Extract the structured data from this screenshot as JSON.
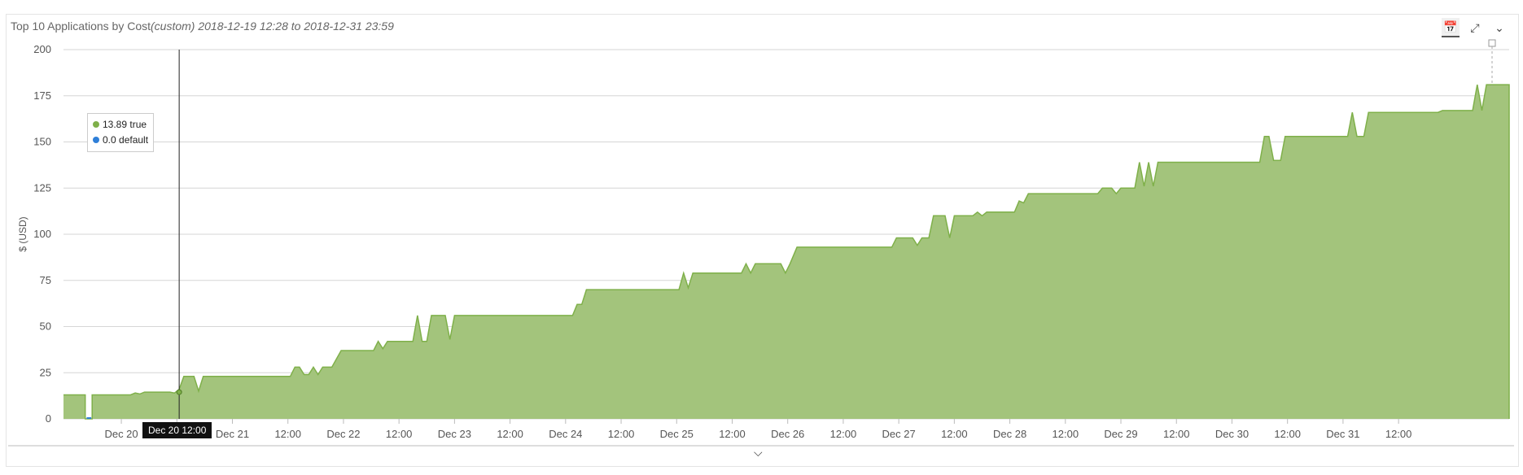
{
  "header": {
    "title_main": "Top 10 Applications by Cost",
    "title_range": "(custom) 2018-12-19 12:28 to 2018-12-31 23:59"
  },
  "toolbar": {
    "calendar_icon": "calendar-icon",
    "expand_icon": "expand-icon",
    "collapse_icon": "chevron-down-icon"
  },
  "legend": {
    "items": [
      {
        "value": "13.89",
        "label": "true",
        "color": "#7fb04a"
      },
      {
        "value": "0.0",
        "label": "default",
        "color": "#2f7fd8"
      }
    ]
  },
  "tooltip": {
    "label": "Dec 20 12:00"
  },
  "chart_data": {
    "type": "area",
    "ylabel": "$ (USD)",
    "ylim": [
      0,
      200
    ],
    "yticks": [
      0,
      25,
      50,
      75,
      100,
      125,
      150,
      175,
      200
    ],
    "grid": true,
    "xticks": [
      "Dec 20",
      "12:00",
      "Dec 21",
      "12:00",
      "Dec 22",
      "12:00",
      "Dec 23",
      "12:00",
      "Dec 24",
      "12:00",
      "Dec 25",
      "12:00",
      "Dec 26",
      "12:00",
      "Dec 27",
      "12:00",
      "Dec 28",
      "12:00",
      "Dec 29",
      "12:00",
      "Dec 30",
      "12:00",
      "Dec 31",
      "12:00"
    ],
    "xtick_hours": [
      0,
      12,
      24,
      36,
      48,
      60,
      72,
      84,
      96,
      108,
      120,
      132,
      144,
      156,
      168,
      180,
      192,
      204,
      216,
      228,
      240,
      252,
      264,
      276
    ],
    "x_range_hours": [
      -12.5,
      299.9
    ],
    "series": [
      {
        "name": "true",
        "color": "#7fb04a",
        "points": [
          [
            -12.5,
            13
          ],
          [
            -7.8,
            13
          ],
          [
            -7.8,
            0
          ],
          [
            -6.3,
            0
          ],
          [
            -6.3,
            13
          ],
          [
            2,
            13
          ],
          [
            3,
            14
          ],
          [
            4,
            13.5
          ],
          [
            5,
            14.5
          ],
          [
            10.5,
            14.5
          ],
          [
            11.5,
            14
          ],
          [
            12.5,
            16
          ],
          [
            13.5,
            23
          ],
          [
            15.7,
            23
          ],
          [
            16.7,
            15
          ],
          [
            17.7,
            23
          ],
          [
            36.5,
            23
          ],
          [
            37.5,
            28
          ],
          [
            38.5,
            28
          ],
          [
            39.5,
            24
          ],
          [
            40.5,
            24
          ],
          [
            41.5,
            28
          ],
          [
            42.5,
            24
          ],
          [
            43.5,
            28
          ],
          [
            45.5,
            28
          ],
          [
            47.5,
            37
          ],
          [
            54.5,
            37
          ],
          [
            55.5,
            42
          ],
          [
            56.5,
            38
          ],
          [
            57.5,
            42
          ],
          [
            63,
            42
          ],
          [
            64,
            56
          ],
          [
            65,
            42
          ],
          [
            66,
            42
          ],
          [
            67,
            56
          ],
          [
            70,
            56
          ],
          [
            71,
            43
          ],
          [
            72,
            56
          ],
          [
            97.5,
            56
          ],
          [
            98.5,
            62
          ],
          [
            99.5,
            62
          ],
          [
            100.5,
            70
          ],
          [
            120.5,
            70
          ],
          [
            121.5,
            79
          ],
          [
            122.5,
            71
          ],
          [
            123.5,
            79
          ],
          [
            134,
            79
          ],
          [
            135,
            84
          ],
          [
            136,
            79
          ],
          [
            137,
            84
          ],
          [
            142.5,
            84
          ],
          [
            143.5,
            79
          ],
          [
            144.5,
            84
          ],
          [
            146,
            93
          ],
          [
            166.5,
            93
          ],
          [
            167.5,
            98
          ],
          [
            171,
            98
          ],
          [
            172,
            94
          ],
          [
            173,
            98
          ],
          [
            174.5,
            98
          ],
          [
            175.5,
            110
          ],
          [
            178,
            110
          ],
          [
            179,
            98
          ],
          [
            180,
            110
          ],
          [
            184,
            110
          ],
          [
            185,
            112
          ],
          [
            186,
            110
          ],
          [
            187,
            112
          ],
          [
            193,
            112
          ],
          [
            194,
            118
          ],
          [
            195,
            117
          ],
          [
            196,
            122
          ],
          [
            211,
            122
          ],
          [
            212,
            125
          ],
          [
            214,
            125
          ],
          [
            215,
            122
          ],
          [
            216,
            125
          ],
          [
            219,
            125
          ],
          [
            220,
            139
          ],
          [
            221,
            126
          ],
          [
            222,
            139
          ],
          [
            223,
            126
          ],
          [
            224,
            139
          ],
          [
            241,
            139
          ],
          [
            242,
            139
          ],
          [
            243,
            139
          ],
          [
            246,
            139
          ],
          [
            247,
            153
          ],
          [
            248,
            153
          ],
          [
            249,
            140
          ],
          [
            250.5,
            140
          ],
          [
            251.5,
            153
          ],
          [
            265,
            153
          ],
          [
            266,
            166
          ],
          [
            267,
            153
          ],
          [
            268.5,
            153
          ],
          [
            269.5,
            166
          ],
          [
            284.5,
            166
          ],
          [
            285.5,
            167
          ],
          [
            292,
            167
          ],
          [
            293,
            181
          ],
          [
            294,
            167
          ],
          [
            295,
            181
          ],
          [
            299.9,
            181
          ],
          [
            299.9,
            0
          ]
        ]
      },
      {
        "name": "default",
        "color": "#2f7fd8",
        "points": [
          [
            -7.5,
            0
          ],
          [
            -6.5,
            0
          ]
        ]
      }
    ]
  }
}
